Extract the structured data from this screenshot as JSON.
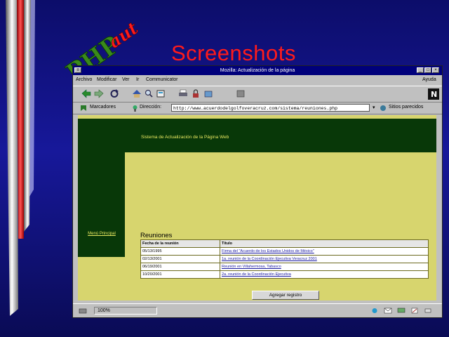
{
  "slide": {
    "logo_text": "PHPaut",
    "title": "Screenshots"
  },
  "browser": {
    "window_title": "Mozilla: Actualización de la página",
    "menu": [
      "Archivo",
      "Modificar",
      "Ver",
      "Ir",
      "Communicator",
      "Ayuda"
    ],
    "bookmarks_label": "Marcadores",
    "address_label": "Dirección:",
    "url": "http://www.acuerdodelgolfoveracruz.com/sistema/reuniones.php",
    "related_label": "Sitios parecidos",
    "zoom": "100%"
  },
  "page": {
    "header": "Sistema de Actualización de la Página Web",
    "menu_link": "Menú Principal",
    "section_title": "Reuniones",
    "columns": [
      "Fecha de la reunión",
      "Título"
    ],
    "rows": [
      {
        "date": "05/13/1995",
        "title": "Firma del \"Acuerdo de los Estados Unidos de México\""
      },
      {
        "date": "02/13/2001",
        "title": "1a. reunión de la Coordinación Ejecutiva Veracruz 2001"
      },
      {
        "date": "06/19/2001",
        "title": "Reunión en Villahermosa, Tabasco"
      },
      {
        "date": "10/20/2001",
        "title": "2a. reunión de la Coordinación Ejecutiva"
      }
    ],
    "add_button": "Agregar registro"
  },
  "colors": {
    "background": "#0c0d6a",
    "slide_title": "#ff1b1b",
    "page_bg": "#d7d56e",
    "page_band": "#083808",
    "header_text": "#e8e860"
  }
}
